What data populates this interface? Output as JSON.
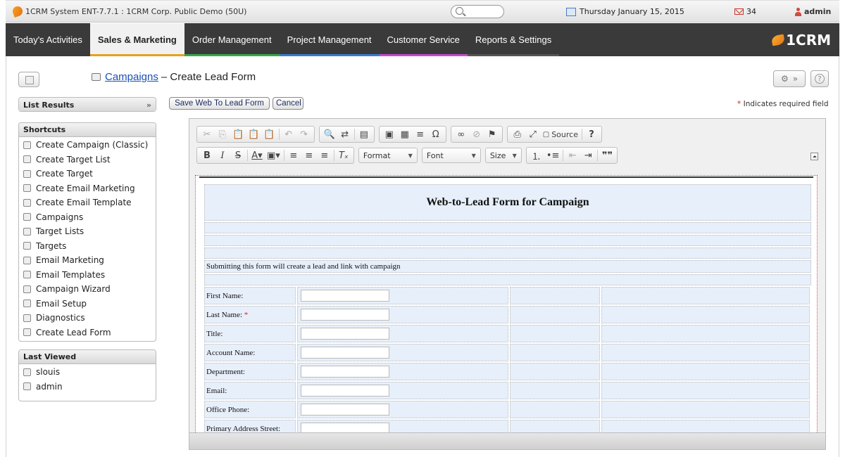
{
  "app": {
    "system_title": "1CRM System ENT-7.7.1 : 1CRM Corp. Public Demo (50U)",
    "date": "Thursday January 15, 2015",
    "mail_count": "34",
    "username": "admin",
    "brand": "1CRM",
    "colors": {
      "accent_orange": "#e6701b",
      "nav_bg": "#3a3a3a",
      "link": "#1a4fb4",
      "required": "#dd2222"
    }
  },
  "nav": {
    "tabs": [
      {
        "label": "Today's Activities",
        "underline": ""
      },
      {
        "label": "Sales & Marketing",
        "underline": "#e6a11b"
      },
      {
        "label": "Order Management",
        "underline": "#37a64a"
      },
      {
        "label": "Project Management",
        "underline": "#3b7bd4"
      },
      {
        "label": "Customer Service",
        "underline": "#c64ad0"
      },
      {
        "label": "Reports & Settings",
        "underline": "#555"
      }
    ]
  },
  "page": {
    "breadcrumb_link": "Campaigns",
    "title_suffix": "– Create Lead Form",
    "save_label": "Save Web To Lead Form",
    "cancel_label": "Cancel",
    "required_note": "Indicates required field",
    "required_star": "*"
  },
  "sidebar": {
    "list_results": "List Results",
    "shortcuts_title": "Shortcuts",
    "shortcuts": [
      "Create Campaign (Classic)",
      "Create Target List",
      "Create Target",
      "Create Email Marketing",
      "Create Email Template",
      "Campaigns",
      "Target Lists",
      "Targets",
      "Email Marketing",
      "Email Templates",
      "Campaign Wizard",
      "Email Setup",
      "Diagnostics",
      "Create Lead Form"
    ],
    "last_viewed_title": "Last Viewed",
    "last_viewed": [
      "slouis",
      "admin"
    ]
  },
  "editor": {
    "format_label": "Format",
    "font_label": "Font",
    "size_label": "Size",
    "source_label": "Source",
    "help_label": "?",
    "doc": {
      "heading": "Web-to-Lead Form for Campaign",
      "message": "Submitting this form will create a lead and link with campaign",
      "fields": [
        {
          "label": "First Name:",
          "required": false
        },
        {
          "label": "Last Name:",
          "required": true
        },
        {
          "label": "Title:",
          "required": false
        },
        {
          "label": "Account Name:",
          "required": false
        },
        {
          "label": "Department:",
          "required": false
        },
        {
          "label": "Email:",
          "required": false
        },
        {
          "label": "Office Phone:",
          "required": false
        },
        {
          "label": "Primary Address Street:",
          "required": false
        }
      ]
    }
  }
}
